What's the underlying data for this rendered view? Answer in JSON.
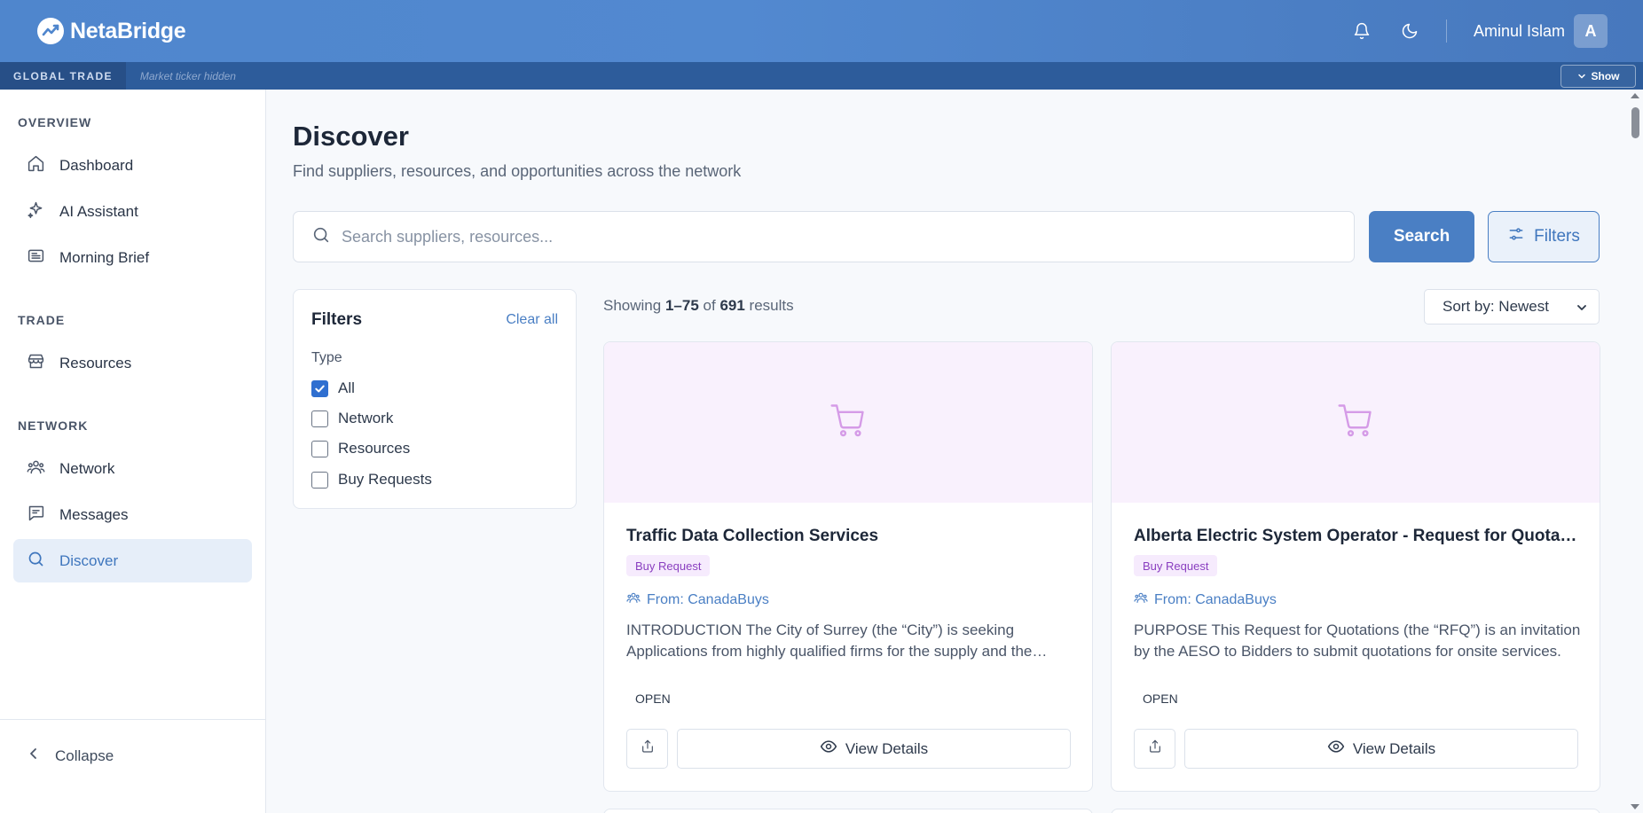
{
  "header": {
    "brand_name": "NetaBridge",
    "user_name": "Aminul Islam",
    "avatar_initial": "A",
    "icons": [
      "bell-icon",
      "moon-icon"
    ],
    "accent_color": "#4f86cd"
  },
  "ticker": {
    "label": "GLOBAL TRADE",
    "hidden_text": "Market ticker hidden",
    "show_label": "Show"
  },
  "sidebar": {
    "sections": [
      {
        "title": "OVERVIEW"
      },
      {
        "title": "TRADE"
      },
      {
        "title": "NETWORK"
      }
    ],
    "items": [
      {
        "label": "Dashboard",
        "icon": "home-icon"
      },
      {
        "label": "AI Assistant",
        "icon": "sparkle-icon"
      },
      {
        "label": "Morning Brief",
        "icon": "newspaper-icon"
      },
      {
        "label": "Resources",
        "icon": "store-icon"
      },
      {
        "label": "Network",
        "icon": "users-icon"
      },
      {
        "label": "Messages",
        "icon": "message-icon"
      },
      {
        "label": "Discover",
        "icon": "search-icon",
        "active": true
      }
    ],
    "collapse_label": "Collapse"
  },
  "main": {
    "title": "Discover",
    "subtitle": "Find suppliers, resources, and opportunities across the network",
    "search": {
      "placeholder": "Search suppliers, resources...",
      "value": "",
      "button_label": "Search",
      "filters_label": "Filters"
    },
    "filters": {
      "title": "Filters",
      "clear_label": "Clear all",
      "type_label": "Type",
      "options": [
        {
          "label": "All",
          "checked": true
        },
        {
          "label": "Network",
          "checked": false
        },
        {
          "label": "Resources",
          "checked": false
        },
        {
          "label": "Buy Requests",
          "checked": false
        }
      ]
    },
    "results": {
      "prefix": "Showing",
      "range": "1–75",
      "of": "of",
      "total": "691",
      "suffix": "results",
      "sort_label": "Sort by: Newest"
    },
    "cards": [
      {
        "title": "Traffic Data Collection Services",
        "badge": "Buy Request",
        "from": "From: CanadaBuys",
        "description": "INTRODUCTION The City of Surrey (the “City”) is seeking Applications from highly qualified firms for the supply and the delivery of traffic data collection services.",
        "status": "OPEN",
        "view_label": "View Details"
      },
      {
        "title": "Alberta Electric System Operator - Request for Quotations",
        "badge": "Buy Request",
        "from": "From: CanadaBuys",
        "description": "PURPOSE This Request for Quotations (the “RFQ”) is an invitation by the AESO to Bidders to submit quotations for onsite services.",
        "status": "OPEN",
        "view_label": "View Details"
      }
    ]
  }
}
